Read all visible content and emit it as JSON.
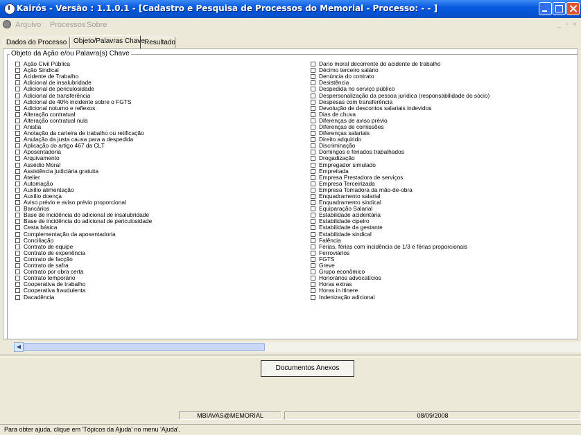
{
  "window": {
    "title": "Kairós - Versão : 1.1.0.1 - [Cadastro e Pesquisa de Processos do Memorial - Processo: - - ]"
  },
  "menu": {
    "items": [
      "Arquivo",
      "Processos",
      "Sobre"
    ],
    "mdi_controls": "_ ▫ ×"
  },
  "tabs": [
    "Dados do Processo",
    "Objeto/Palavras Chave",
    "Resultado"
  ],
  "group": {
    "legend": "Objeto da Ação e/ou Palavra(s) Chave"
  },
  "checklist": {
    "left": [
      "Ação Civil Pública",
      "Ação Sindical",
      "Acidente de Trabalho",
      "Adicional de insalubridade",
      "Adicional de periculosidade",
      "Adicional de transferência",
      "Adicional de 40% incidente sobre o FGTS",
      "Adicional noturno e reflexos",
      "Alteração contratual",
      "Alteração contratual nula",
      "Anistia",
      "Anotação da carteira de trabalho ou retificação",
      "Anulação da justa causa para a despedida",
      "Aplicação do artigo 467 da CLT",
      "Aposentadoria",
      "Arquivamento",
      "Assédio Moral",
      "Assistência judiciária gratuita",
      "Atelier",
      "Automação",
      "Auxílio alimentação",
      "Auxílio doença",
      "Aviso prévio e aviso prévio proporcional",
      "Bancários",
      "Base de incidência do adicional de insalubridade",
      "Base de incidência do adicional de periculosidade",
      "Cesta básica",
      "Complementação da aposentadoria",
      "Conciliação",
      "Contrato de equipe",
      "Contrato de experiência",
      "Contrato de facção",
      "Contrato de safra",
      "Contrato por obra certa",
      "Contrato temporário",
      "Cooperativa de trabalho",
      "Cooperativa fraudulenta",
      "Dacadência"
    ],
    "right": [
      "Dano moral decorrente do acidente de trabalho",
      "Décimo terceiro salário",
      "Denúncia do contrato",
      "Desistência",
      "Despedida no serviço público",
      "Despersonalização da pessoa jurídica (responsabilidade do sócio)",
      "Despesas com transferência",
      "Devolução de descontos salariais indevidos",
      "Dias de chuva",
      "Diferenças de aviso prévio",
      "Diferenças de comissões",
      "Diferenças salariais",
      "Direito adquirido",
      "Discriminação",
      "Domingos e feriados trabalhados",
      "Drogadização",
      "Empregador simulado",
      "Empreitada",
      "Empresa Prestadora de serviços",
      "Empresa Terceirizada",
      "Empresa Tomadora da mão-de-obra",
      "Enquadramento salarial",
      "Enquadramento sindical",
      "Equiparação Salarial",
      "Estabilidade acidentária",
      "Estabilidade cipeiro",
      "Estabilidade da gestante",
      "Estabilidade sindical",
      "Falência",
      "Férias, férias com incidência de 1/3 e férias proporcionais",
      "Ferroviários",
      "FGTS",
      "Greve",
      "Grupo econômico",
      "Honorários advocatícios",
      "Horas extras",
      "Horas in itinere",
      "Indenização adicional"
    ]
  },
  "buttons": {
    "documentos_anexos": "Documentos Anexos"
  },
  "status": {
    "user": "MBIAVAS@MEMORIAL",
    "date": "08/09/2008",
    "help": "Para obter ajuda, clique em 'Tópicos da Ajuda' no menu 'Ajuda'."
  },
  "colors": {
    "titlebar": "#0553d6",
    "window_bg": "#ece9d8",
    "close_button": "#e0522c"
  }
}
